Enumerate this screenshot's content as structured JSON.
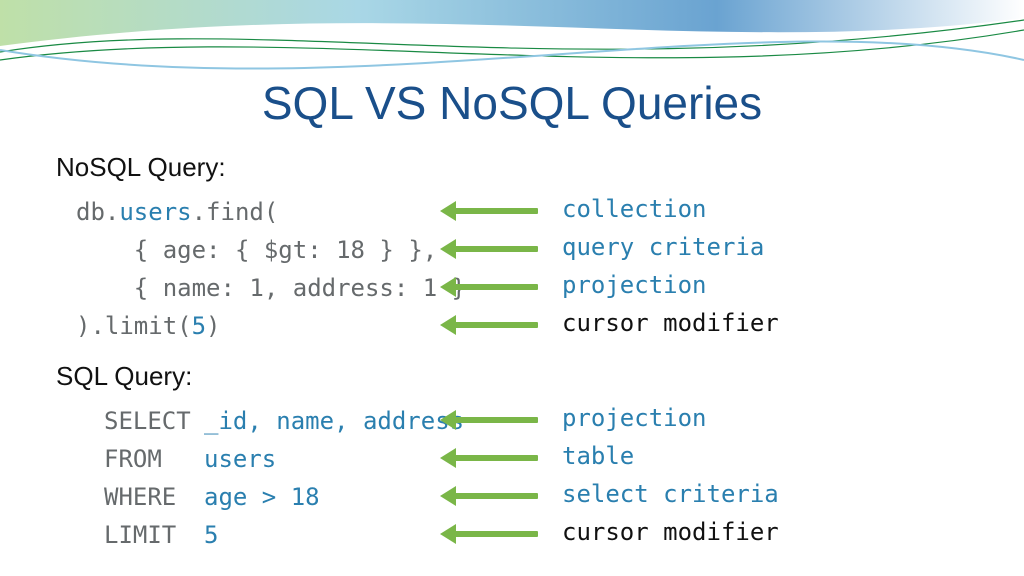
{
  "title": "SQL VS NoSQL Queries",
  "nosql": {
    "label": "NoSQL Query:",
    "code": {
      "l1a": "db.",
      "l1b": "users",
      "l1c": ".find(",
      "l2": "    { age: { $gt: 18 } },",
      "l3": "    { name: 1, address: 1 }",
      "l4a": ").limit(",
      "l4b": "5",
      "l4c": ")"
    },
    "ann": {
      "a1": "collection",
      "a2": "query criteria",
      "a3": "projection",
      "a4": "cursor modifier"
    }
  },
  "sql": {
    "label": "SQL Query:",
    "code": {
      "k1": "SELECT",
      "v1": "_id, name, address",
      "k2": "FROM",
      "v2": "users",
      "k3": "WHERE",
      "v3": "age > 18",
      "k4": "LIMIT",
      "v4": "5"
    },
    "ann": {
      "a1": "projection",
      "a2": "table",
      "a3": "select criteria",
      "a4": "cursor modifier"
    }
  }
}
